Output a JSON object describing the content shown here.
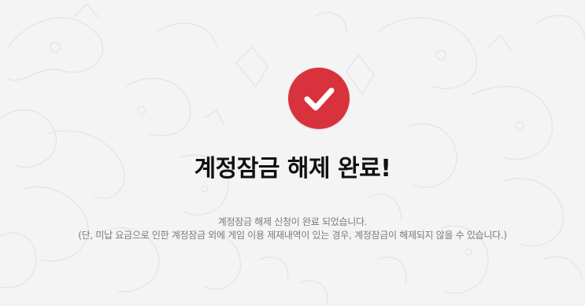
{
  "page": {
    "title": "계정잠금 해제 완료!",
    "description_line1": "계정잠금 해제 신청이 완료 되었습니다.",
    "description_line2": "(단, 미납 요금으로 인한 계정잠금 외에 게임 이용 제재내역이 있는 경우, 계정잠금이 해제되지 않을 수 있습니다.)"
  },
  "icons": {
    "status": "check-icon"
  },
  "colors": {
    "accent": "#d8333c",
    "title": "#111111",
    "description": "#7a7a7a",
    "background": "#f4f4f4"
  }
}
